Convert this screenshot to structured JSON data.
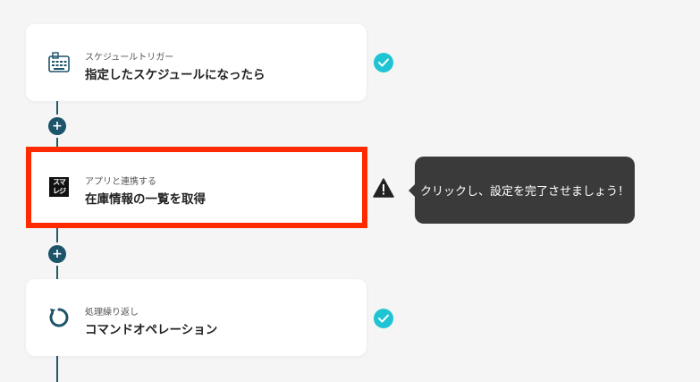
{
  "flow": {
    "steps": [
      {
        "subtitle": "スケジュールトリガー",
        "title": "指定したスケジュールになったら",
        "icon": "calendar-keyboard-icon",
        "status": "complete"
      },
      {
        "subtitle": "アプリと連携する",
        "title": "在庫情報の一覧を取得",
        "icon": "smaregi-logo-icon",
        "logo_text_top": "スマ",
        "logo_text_bottom": "レジ",
        "status": "warning"
      },
      {
        "subtitle": "処理繰り返し",
        "title": "コマンドオペレーション",
        "icon": "loop-icon",
        "status": "complete"
      }
    ],
    "add_button_label": "+"
  },
  "tooltip": {
    "text": "クリックし、設定を完了させましょう！"
  },
  "colors": {
    "background": "#f5f5f5",
    "connector": "#1d5469",
    "check": "#1fc4d4",
    "highlight": "#ff2a00",
    "tooltip_bg": "#3a3a3a",
    "icon_teal": "#1d5469"
  }
}
